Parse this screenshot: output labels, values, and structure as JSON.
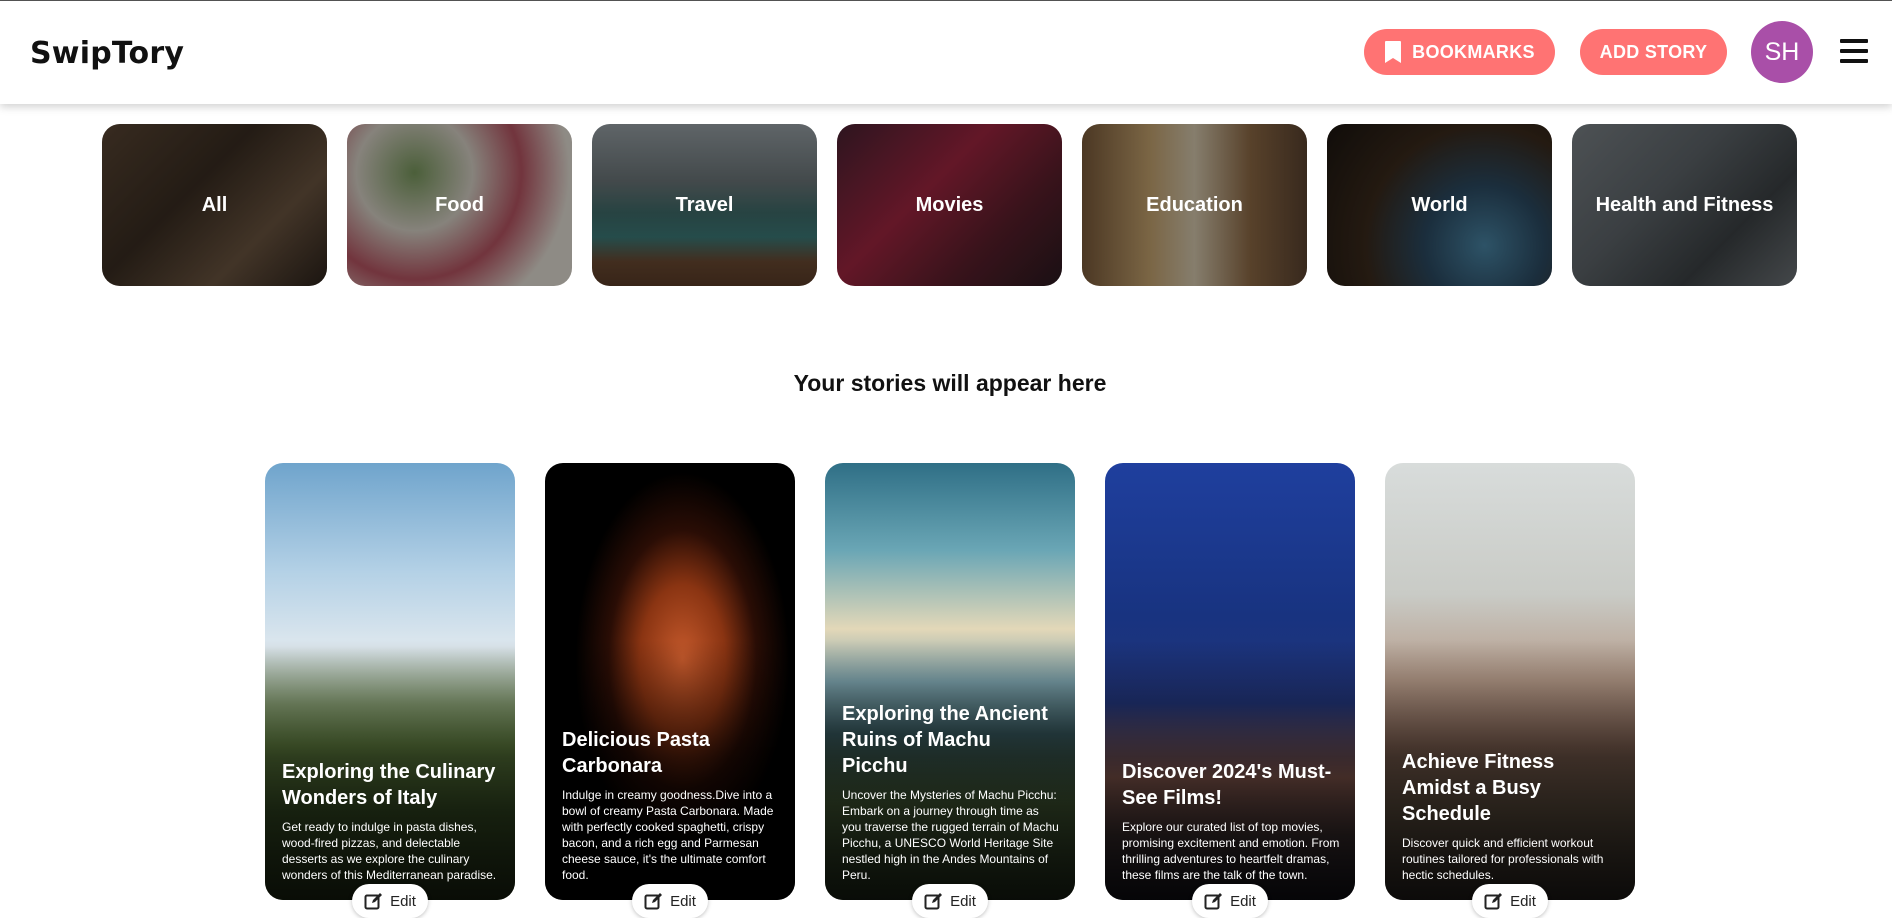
{
  "app": {
    "logo": "SwipTory"
  },
  "header": {
    "bookmarks_label": "BOOKMARKS",
    "bookmark_icon": "bookmark-icon",
    "add_story_label": "ADD STORY",
    "avatar_initials": "SH",
    "menu_icon": "hamburger-menu-icon",
    "accent_color": "#ff7373",
    "avatar_color": "#a94fa8"
  },
  "categories": [
    {
      "label": "All"
    },
    {
      "label": "Food"
    },
    {
      "label": "Travel"
    },
    {
      "label": "Movies"
    },
    {
      "label": "Education"
    },
    {
      "label": "World"
    },
    {
      "label": "Health and Fitness"
    }
  ],
  "section_title": "Your stories will appear here",
  "stories": [
    {
      "title": "Exploring the Culinary Wonders of Italy",
      "description": "Get ready to indulge in pasta dishes, wood-fired pizzas, and delectable desserts as we explore the culinary wonders of this Mediterranean paradise.",
      "edit_label": "Edit"
    },
    {
      "title": "Delicious Pasta Carbonara",
      "description": "Indulge in creamy goodness.Dive into a bowl of creamy Pasta Carbonara. Made with perfectly cooked spaghetti, crispy bacon, and a rich egg and Parmesan cheese sauce, it's the ultimate comfort food.",
      "edit_label": "Edit"
    },
    {
      "title": "Exploring the Ancient Ruins of Machu Picchu",
      "description": "Uncover the Mysteries of Machu Picchu: Embark on a journey through time as you traverse the rugged terrain of Machu Picchu, a UNESCO World Heritage Site nestled high in the Andes Mountains of Peru.",
      "edit_label": "Edit"
    },
    {
      "title": "Discover 2024's Must-See Films!",
      "description": "Explore our curated list of top movies, promising excitement and emotion. From thrilling adventures to heartfelt dramas, these films are the talk of the town.",
      "edit_label": "Edit"
    },
    {
      "title": "Achieve Fitness Amidst a Busy Schedule",
      "description": "Discover quick and efficient workout routines tailored for professionals with hectic schedules.",
      "edit_label": "Edit"
    }
  ]
}
